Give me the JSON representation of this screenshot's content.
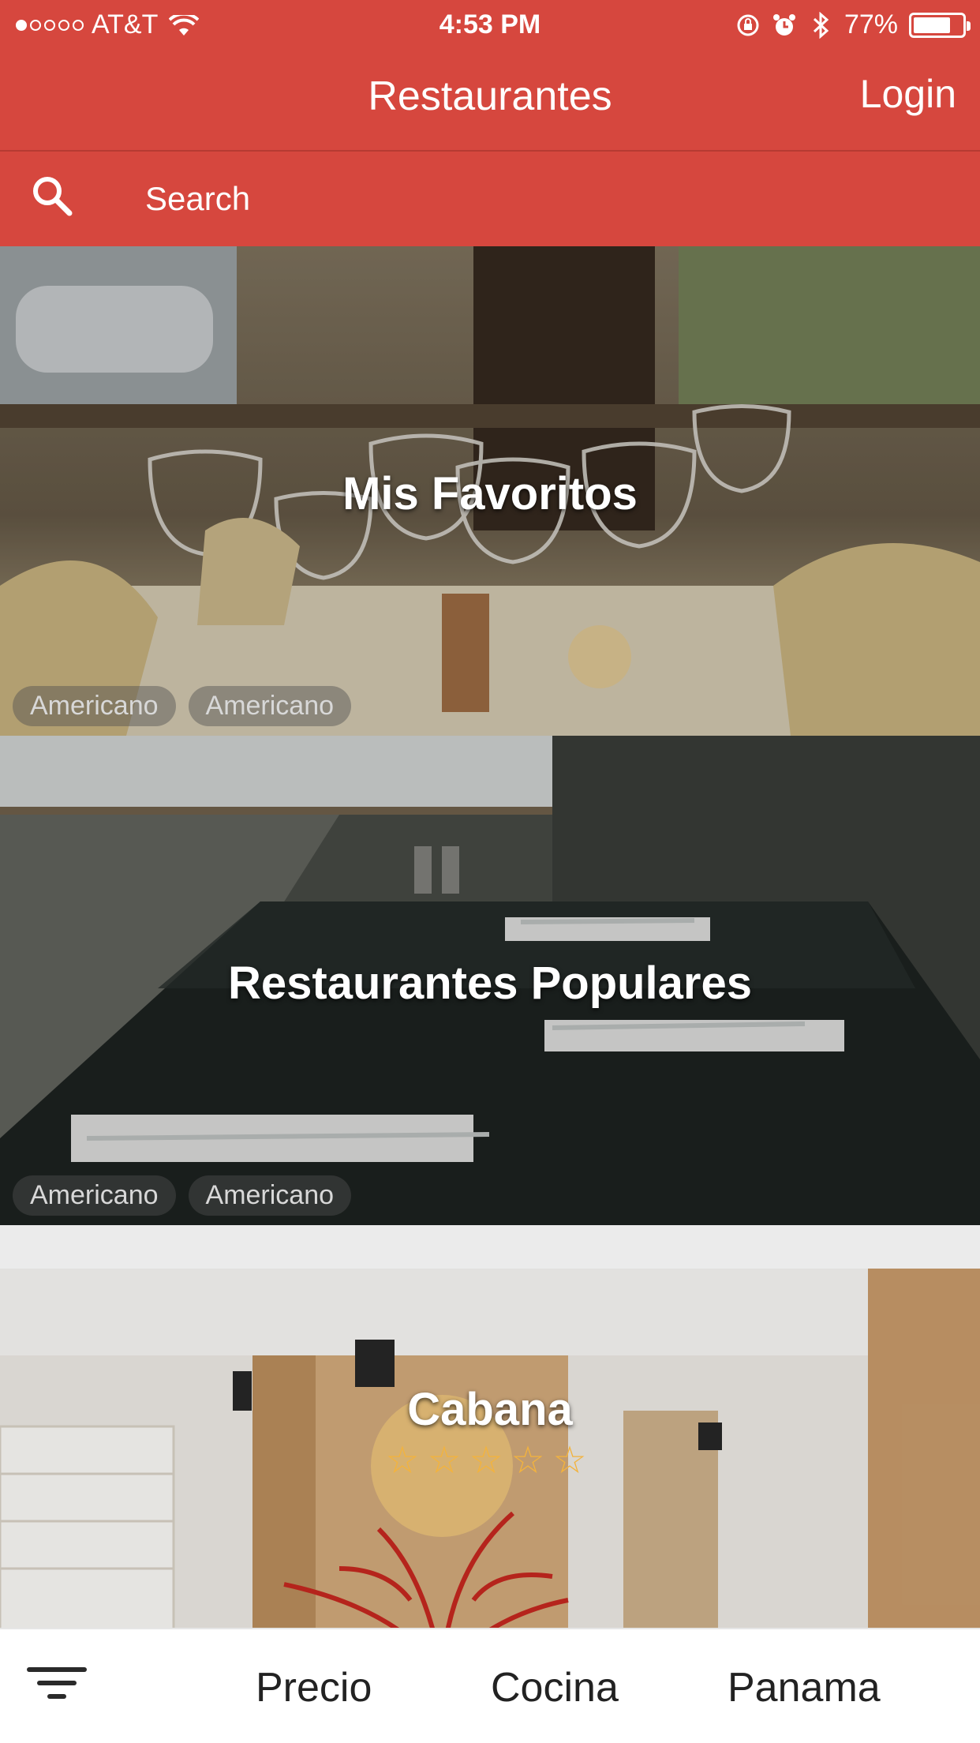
{
  "status_bar": {
    "carrier": "AT&T",
    "time": "4:53 PM",
    "battery_percent": "77%",
    "battery_level": 0.77
  },
  "header": {
    "title": "Restaurantes",
    "login_label": "Login"
  },
  "search": {
    "placeholder": "Search"
  },
  "cards": [
    {
      "title": "Mis Favoritos",
      "tags": [
        "Americano",
        "Americano"
      ]
    },
    {
      "title": "Restaurantes Populares",
      "tags": [
        "Americano",
        "Americano"
      ]
    },
    {
      "title": "Cabana",
      "rating": 0,
      "max_rating": 5
    }
  ],
  "bottom_bar": {
    "filter_icon": "filter-icon",
    "items": [
      "Precio",
      "Cocina",
      "Panama"
    ]
  },
  "colors": {
    "header": "#d6473e",
    "star": "#f3b33d"
  }
}
